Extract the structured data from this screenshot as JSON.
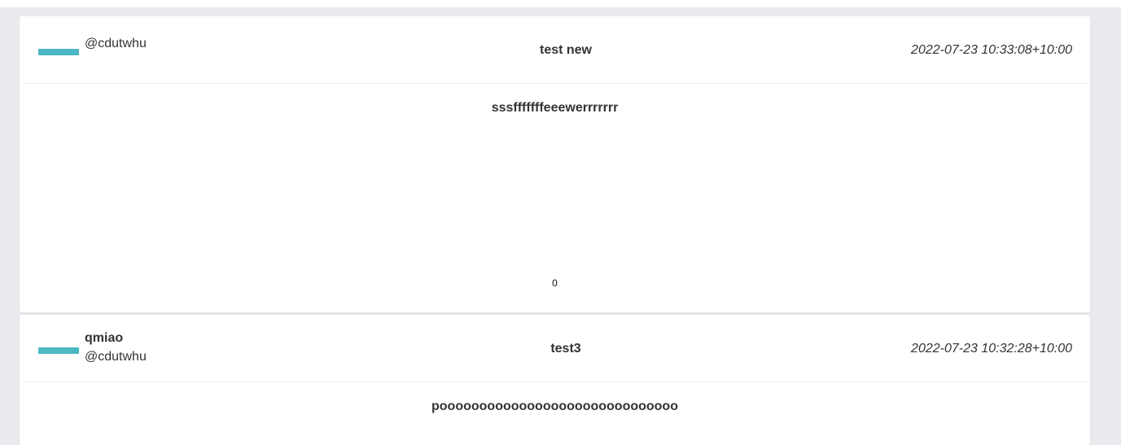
{
  "posts": [
    {
      "name": "",
      "handle": "@cdutwhu",
      "title": "test new",
      "timestamp": "2022-07-23 10:33:08+10:00",
      "content": "sssfffffffeeewerrrrrrr",
      "count": "0"
    },
    {
      "name": "qmiao",
      "handle": "@cdutwhu",
      "title": "test3",
      "timestamp": "2022-07-23 10:32:28+10:00",
      "content": "poooooooooooooooooooooooooooooo"
    }
  ],
  "colors": {
    "avatar_accent": "#4bb8c4",
    "page_background": "#e9e9ee",
    "card_background": "#ffffff"
  }
}
